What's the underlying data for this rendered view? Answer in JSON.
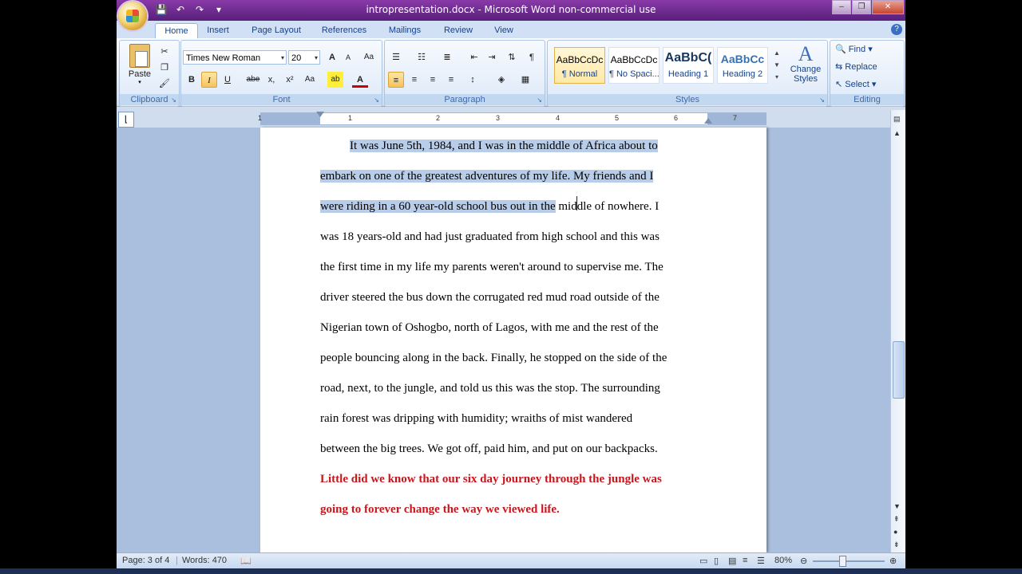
{
  "titlebar": {
    "title": "intropresentation.docx - Microsoft Word non-commercial use",
    "qat": [
      "💾",
      "↶",
      "↷",
      "▾"
    ],
    "win_buttons": [
      "–",
      "❐",
      "✕"
    ]
  },
  "tabs": [
    {
      "label": "Home"
    },
    {
      "label": "Insert"
    },
    {
      "label": "Page Layout"
    },
    {
      "label": "References"
    },
    {
      "label": "Mailings"
    },
    {
      "label": "Review"
    },
    {
      "label": "View"
    }
  ],
  "ribbon": {
    "clipboard": {
      "label": "Clipboard",
      "paste": "Paste"
    },
    "font": {
      "label": "Font",
      "font_name": "Times New Roman",
      "font_size": "20",
      "buttons": [
        "A",
        "A",
        "Aa",
        "B",
        "I",
        "U",
        "abe",
        "x,",
        "x²",
        "Aa",
        "ab",
        "A"
      ]
    },
    "paragraph": {
      "label": "Paragraph",
      "pilcrow": "¶"
    },
    "styles": {
      "label": "Styles",
      "items": [
        {
          "preview": "AaBbCcDc",
          "name": "¶ Normal"
        },
        {
          "preview": "AaBbCcDc",
          "name": "¶ No Spaci..."
        },
        {
          "preview": "AaBbC(",
          "name": "Heading 1"
        },
        {
          "preview": "AaBbCc",
          "name": "Heading 2"
        }
      ],
      "change_styles": "Change Styles"
    },
    "editing": {
      "label": "Editing",
      "find": "Find",
      "replace": "Replace",
      "select": "Select"
    }
  },
  "ruler": {
    "numbers": [
      "1",
      "1",
      "2",
      "3",
      "4",
      "5",
      "6",
      "7"
    ]
  },
  "document": {
    "lines": [
      {
        "sel": "It was June 5th, 1984, and I was in the middle of Africa about to",
        "rest": ""
      },
      {
        "sel": "embark on one of the greatest adventures of my life. My friends and I",
        "rest": ""
      },
      {
        "sel": "were riding in a 60 year-old school bus out in the",
        "rest": " middle of nowhere. I"
      },
      {
        "sel": "",
        "rest": "was 18 years-old and had just graduated from high school and this was"
      },
      {
        "sel": "",
        "rest": "the first time in my  life my parents weren't around to supervise me. The"
      },
      {
        "sel": "",
        "rest": "driver steered the bus down the corrugated red mud road outside of the"
      },
      {
        "sel": "",
        "rest": "Nigerian town of Oshogbo, north of Lagos, with me and the rest of the"
      },
      {
        "sel": "",
        "rest": "people bouncing along in the back. Finally, he stopped on the side of the"
      },
      {
        "sel": "",
        "rest": "road, next, to the jungle, and told us this was the stop. The surrounding"
      },
      {
        "sel": "",
        "rest": "rain forest was dripping with humidity; wraiths of mist wandered"
      },
      {
        "sel": "",
        "rest": "between the big trees. We got off, paid him, and put on our backpacks."
      }
    ],
    "red_lines": [
      "Little did we know that our six day journey through the jungle was",
      "going to forever change the way we viewed life."
    ]
  },
  "statusbar": {
    "page": "Page: 3 of 4",
    "words": "Words: 470",
    "zoom": "80%"
  }
}
